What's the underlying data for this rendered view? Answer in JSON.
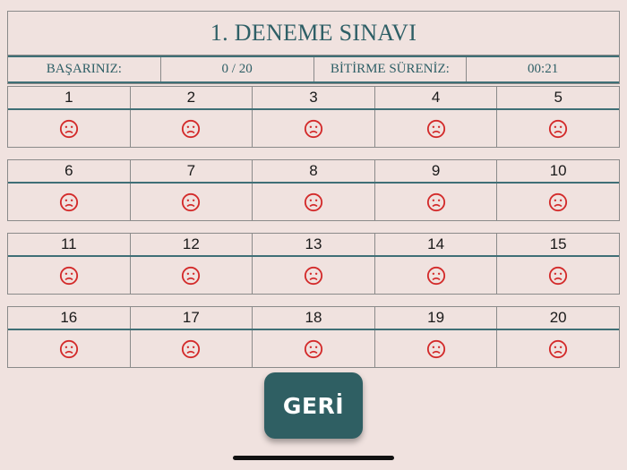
{
  "exam": {
    "title": "1. DENEME SINAVI"
  },
  "info": {
    "success_label": "BAŞARINIZ:",
    "success_value": "0 / 20",
    "time_label": "BİTİRME SÜRENİZ:",
    "time_value": "00:21"
  },
  "questions": [
    [
      "1",
      "2",
      "3",
      "4",
      "5"
    ],
    [
      "6",
      "7",
      "8",
      "9",
      "10"
    ],
    [
      "11",
      "12",
      "13",
      "14",
      "15"
    ],
    [
      "16",
      "17",
      "18",
      "19",
      "20"
    ]
  ],
  "answer_icon": "sad-face-icon",
  "colors": {
    "face": "#d32a2a",
    "accent": "#2f5f63",
    "background": "#f0e2df"
  },
  "back_button": "GERİ"
}
